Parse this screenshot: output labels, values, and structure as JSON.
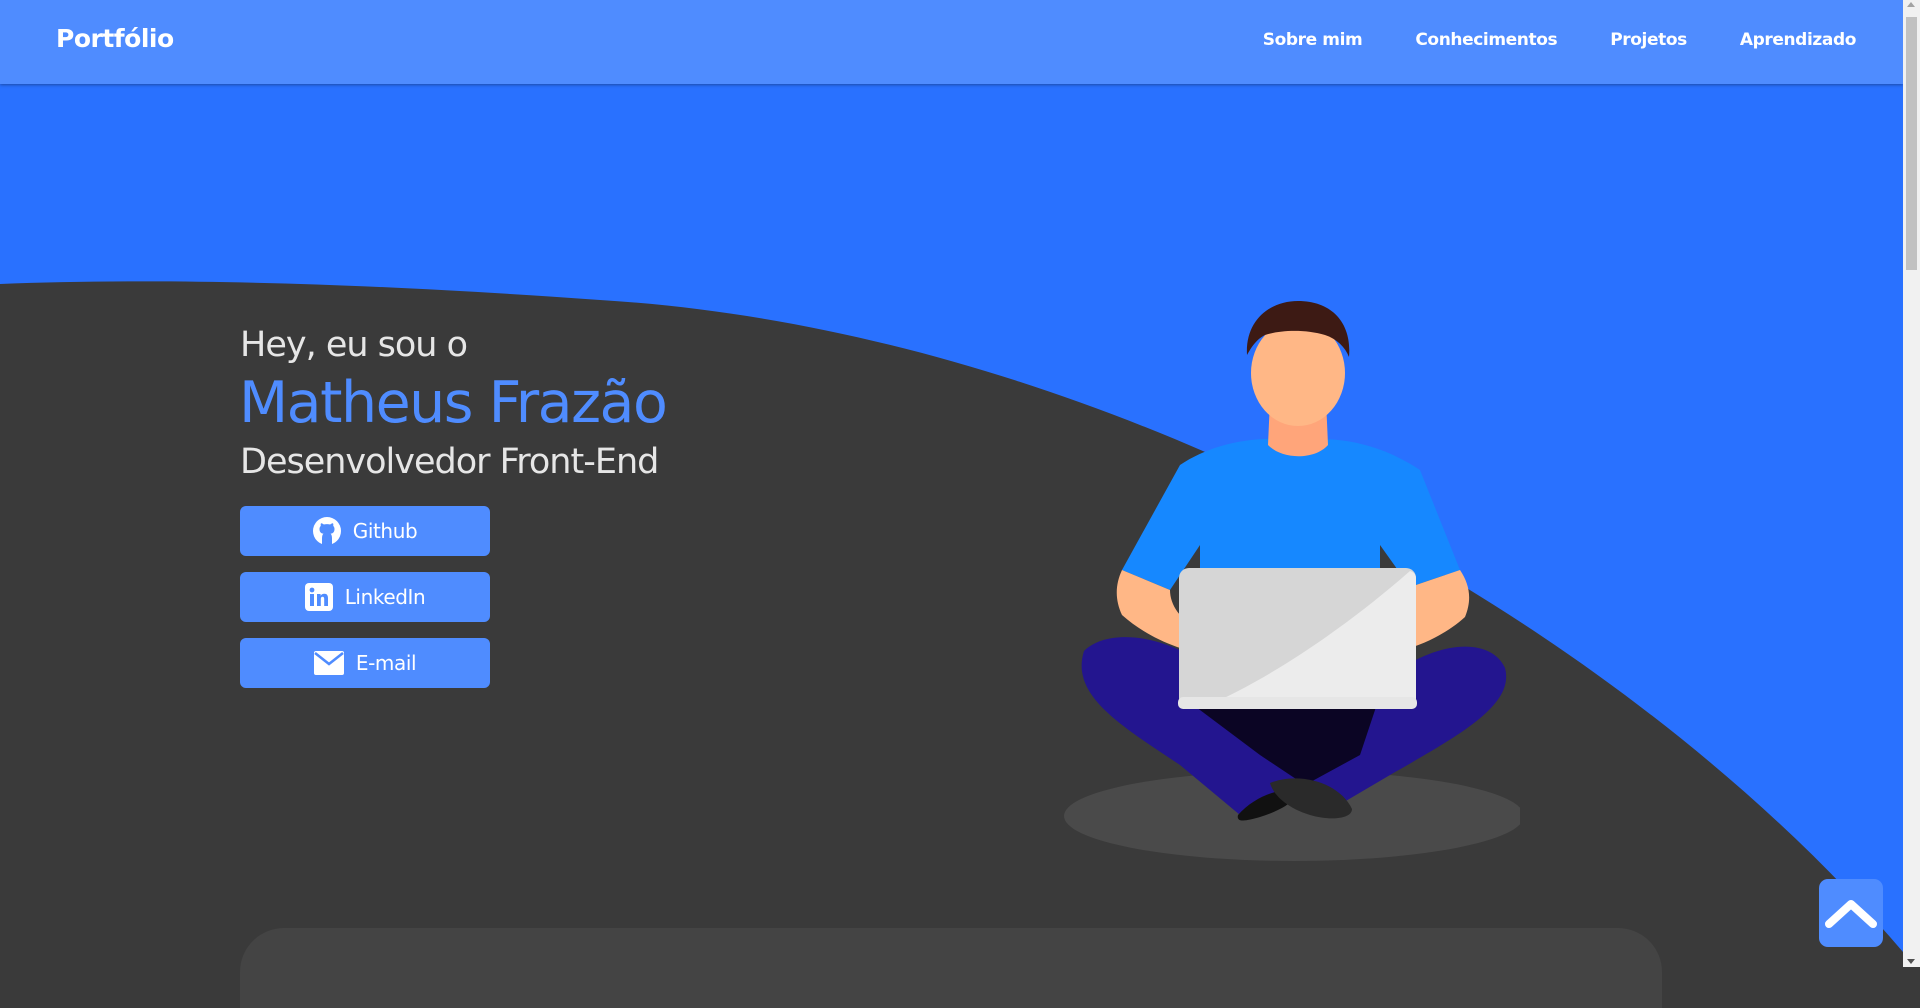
{
  "navbar": {
    "brand": "Portfólio",
    "links": [
      "Sobre mim",
      "Conhecimentos",
      "Projetos",
      "Aprendizado"
    ]
  },
  "hero": {
    "greeting": "Hey, eu sou o",
    "name": "Matheus Frazão",
    "role": "Desenvolvedor Front-End",
    "buttons": [
      {
        "label": "Github",
        "icon": "github-icon"
      },
      {
        "label": "LinkedIn",
        "icon": "linkedin-icon"
      },
      {
        "label": "E-mail",
        "icon": "mail-icon"
      }
    ]
  },
  "colors": {
    "accent": "#4f8cff",
    "hero_blue": "#2971ff",
    "dark_bg": "#3a3a3a",
    "text_light": "#e6e6e6"
  },
  "icons": {
    "back_to_top": "chevron-up-icon",
    "illustration": "person-with-laptop-illustration"
  }
}
